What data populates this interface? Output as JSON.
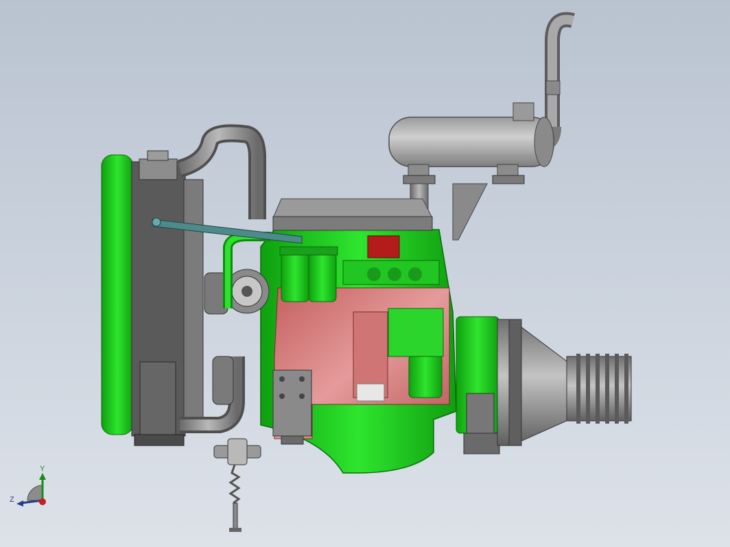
{
  "scene": {
    "background_top": "#b9c3d0",
    "background_bottom": "#dde2e9",
    "engine_block_color": "#1fd11f",
    "cutaway_color": "#d77a7a",
    "metal_color": "#8a8a8a",
    "radiator_color": "#5b5b5b"
  },
  "triad": {
    "y_label": "Y",
    "z_label": "Z",
    "y_color": "#1a8a1a",
    "z_color": "#2b3a8a",
    "x_color": "#c81e1e"
  }
}
